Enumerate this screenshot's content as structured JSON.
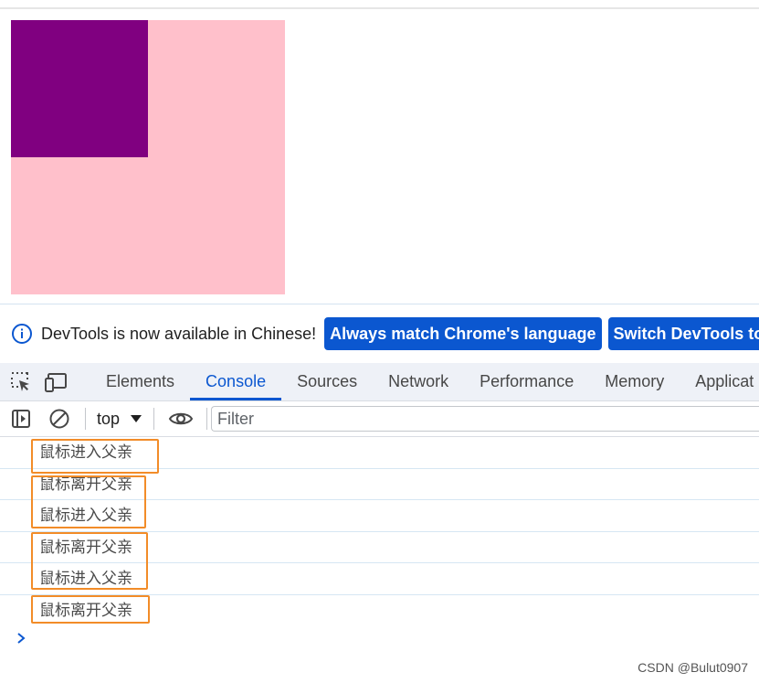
{
  "page": {
    "father_color": "#ffc0cb",
    "son_color": "#800080"
  },
  "infobar": {
    "message": "DevTools is now available in Chinese!",
    "match_button": "Always match Chrome's language",
    "switch_button": "Switch DevTools to Chi"
  },
  "tabs": [
    {
      "label": "Elements",
      "active": false
    },
    {
      "label": "Console",
      "active": true
    },
    {
      "label": "Sources",
      "active": false
    },
    {
      "label": "Network",
      "active": false
    },
    {
      "label": "Performance",
      "active": false
    },
    {
      "label": "Memory",
      "active": false
    },
    {
      "label": "Applicat",
      "active": false
    }
  ],
  "console_toolbar": {
    "context": "top",
    "filter_placeholder": "Filter"
  },
  "console_logs": [
    "鼠标进入父亲",
    "鼠标离开父亲",
    "鼠标进入父亲",
    "鼠标离开父亲",
    "鼠标进入父亲",
    "鼠标离开父亲"
  ],
  "colors": {
    "accent": "#0b57d0",
    "highlight": "#f28c28"
  },
  "watermark": "CSDN @Bulut0907"
}
